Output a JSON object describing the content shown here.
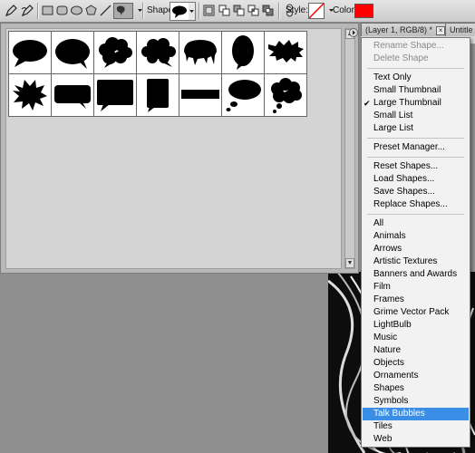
{
  "options_bar": {
    "shape_label": "Shape:",
    "style_label": "Style:",
    "color_label": "Color:",
    "color_value": "#ff0000",
    "tool_icons": [
      "pen-icon",
      "freeform-pen-icon",
      "rectangle-icon",
      "rounded-rectangle-icon",
      "ellipse-icon",
      "polygon-icon",
      "line-icon",
      "custom-shape-icon"
    ],
    "mode_icons": [
      "new-shape-layer-icon",
      "add-icon",
      "subtract-icon",
      "intersect-icon",
      "exclude-icon"
    ]
  },
  "doc_tabs": [
    {
      "label": "(Layer 1, RGB/8) *"
    },
    {
      "label": "Untitle"
    }
  ],
  "shape_picker": {
    "shapes": [
      "oval-bubble",
      "oval-bubble-2",
      "cloud-bubble",
      "cloud-bubble-2",
      "drip-bubble",
      "vertical-oval-bubble",
      "spiky-bubble",
      "burst-bubble",
      "rounded-rect-bubble",
      "rect-bubble",
      "tall-rect-bubble",
      "banner-bar",
      "thought-bubble",
      "cloud-thought-bubble"
    ]
  },
  "menu": {
    "items": [
      {
        "label": "Rename Shape...",
        "disabled": true
      },
      {
        "label": "Delete Shape",
        "disabled": true
      },
      {
        "sep": true
      },
      {
        "label": "Text Only"
      },
      {
        "label": "Small Thumbnail"
      },
      {
        "label": "Large Thumbnail",
        "checked": true
      },
      {
        "label": "Small List"
      },
      {
        "label": "Large List"
      },
      {
        "sep": true
      },
      {
        "label": "Preset Manager..."
      },
      {
        "sep": true
      },
      {
        "label": "Reset Shapes..."
      },
      {
        "label": "Load Shapes..."
      },
      {
        "label": "Save Shapes..."
      },
      {
        "label": "Replace Shapes..."
      },
      {
        "sep": true
      },
      {
        "label": "All"
      },
      {
        "label": "Animals"
      },
      {
        "label": "Arrows"
      },
      {
        "label": "Artistic Textures"
      },
      {
        "label": "Banners and Awards"
      },
      {
        "label": "Film"
      },
      {
        "label": "Frames"
      },
      {
        "label": "Grime Vector Pack"
      },
      {
        "label": "LightBulb"
      },
      {
        "label": "Music"
      },
      {
        "label": "Nature"
      },
      {
        "label": "Objects"
      },
      {
        "label": "Ornaments"
      },
      {
        "label": "Shapes"
      },
      {
        "label": "Symbols"
      },
      {
        "label": "Talk Bubbles",
        "highlighted": true
      },
      {
        "label": "Tiles"
      },
      {
        "label": "Web"
      }
    ]
  }
}
